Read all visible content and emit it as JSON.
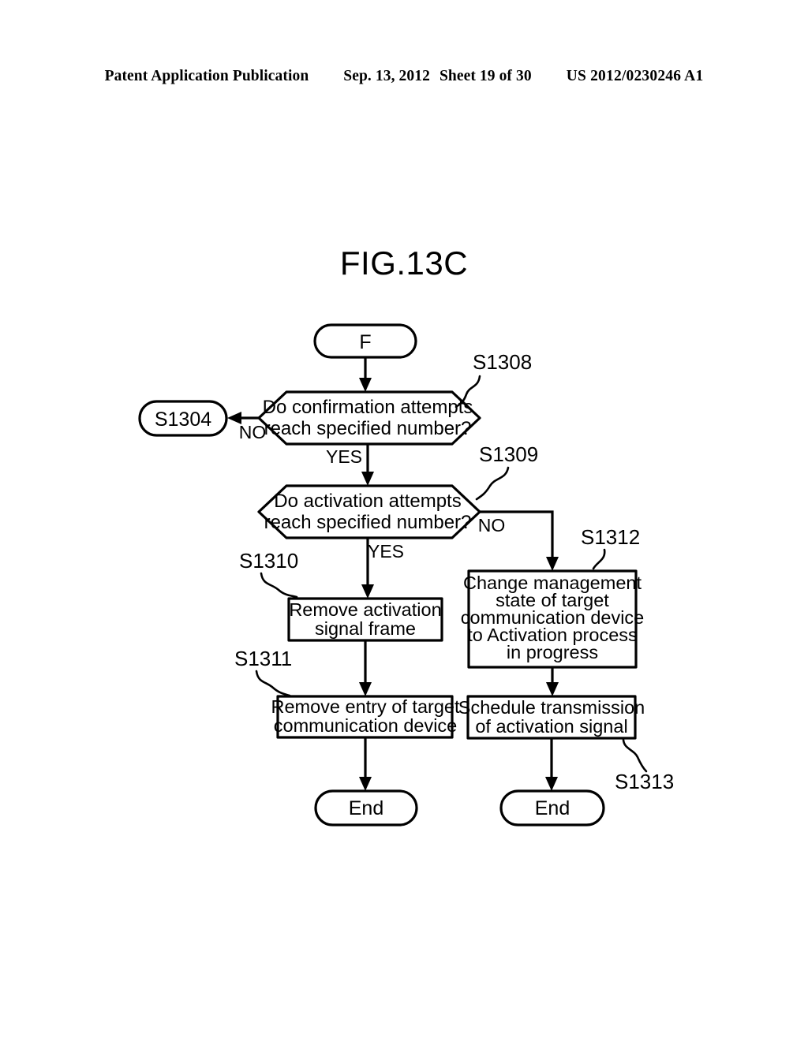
{
  "header": {
    "publication": "Patent Application Publication",
    "date": "Sep. 13, 2012",
    "sheet": "Sheet 19 of 30",
    "number": "US 2012/0230246 A1"
  },
  "figure": {
    "title": "FIG.13C"
  },
  "flowchart": {
    "connector_in": {
      "label": "F"
    },
    "offpage_target": {
      "label": "S1304"
    },
    "decisions": [
      {
        "ref": "S1308",
        "line1": "Do confirmation attempts",
        "line2": "reach specified number?",
        "no_label": "NO",
        "yes_label": "YES"
      },
      {
        "ref": "S1309",
        "line1": "Do activation attempts",
        "line2": "reach specified number?",
        "no_label": "NO",
        "yes_label": "YES"
      }
    ],
    "processes": [
      {
        "ref": "S1310",
        "lines": [
          "Remove activation",
          "signal frame"
        ]
      },
      {
        "ref": "S1311",
        "lines": [
          "Remove entry of target",
          "communication device"
        ]
      },
      {
        "ref": "S1312",
        "lines": [
          "Change management",
          "state of target",
          "communication device",
          "to Activation process",
          "in progress"
        ]
      },
      {
        "ref": "S1313",
        "lines": [
          "Schedule transmission",
          "of activation signal"
        ]
      }
    ],
    "terminals": [
      {
        "label": "End"
      },
      {
        "label": "End"
      }
    ]
  }
}
